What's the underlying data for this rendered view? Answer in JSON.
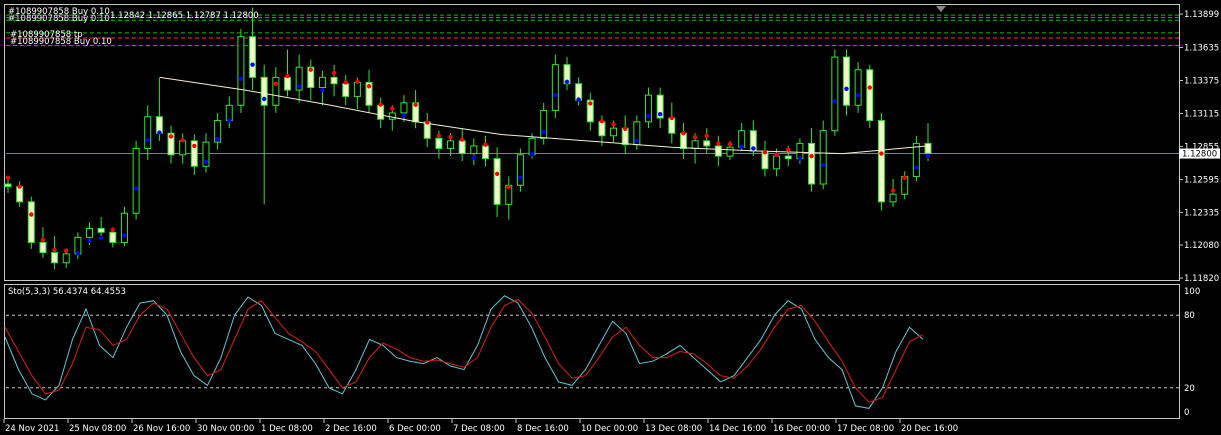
{
  "header": {
    "top_text": "#1089907858 Buy 0.10",
    "quote_text": "1.12842 1.12865 1.12787 1.12800",
    "tp_label": "#1089907858 tp",
    "buy_label": "#1089907858 Buy 0.10"
  },
  "indicator": {
    "label": "Sto(5,3,3) 56.4374 64.4553"
  },
  "colors": {
    "background": "#000000",
    "candle_up_fill": "#000000",
    "candle_down_fill": "#f0f8c8",
    "candle_wick": "#2ee52e",
    "ma_line": "#f5f0d0",
    "psar_up": "#0000ff",
    "psar_down": "#ff0000",
    "stoch_main": "#5fc8d8",
    "stoch_signal": "#e01a1a",
    "level_green": "#00c800",
    "level_red": "#ff3030",
    "grid_dotted": "#c8c8c8",
    "price_line": "#708090"
  },
  "chart_data": [
    {
      "type": "candlestick",
      "price_axis_labels": [
        "1.13899",
        "1.13635",
        "1.13375",
        "1.13115",
        "1.12855",
        "1.12595",
        "1.12335",
        "1.12080",
        "1.11820"
      ],
      "current_price_label": "1.12800",
      "ylim": [
        1.1182,
        1.13899
      ],
      "time_axis_labels": [
        "24 Nov 2021",
        "25 Nov 08:00",
        "26 Nov 16:00",
        "30 Nov 00:00",
        "1 Dec 08:00",
        "2 Dec 16:00",
        "6 Dec 00:00",
        "7 Dec 08:00",
        "8 Dec 16:00",
        "10 Dec 00:00",
        "13 Dec 08:00",
        "14 Dec 16:00",
        "16 Dec 00:00",
        "17 Dec 08:00",
        "20 Dec 16:00"
      ],
      "current_price": 1.128,
      "order_levels": [
        1.1389,
        1.1387,
        1.1385,
        1.1375,
        1.1371,
        1.1365
      ],
      "candles_ohlc": [
        [
          1.1256,
          1.1262,
          1.1249,
          1.1254
        ],
        [
          1.1254,
          1.1258,
          1.1238,
          1.1242
        ],
        [
          1.1242,
          1.1246,
          1.1205,
          1.121
        ],
        [
          1.121,
          1.1222,
          1.1198,
          1.1202
        ],
        [
          1.1202,
          1.1215,
          1.1189,
          1.1194
        ],
        [
          1.1194,
          1.1205,
          1.119,
          1.1201
        ],
        [
          1.1201,
          1.1218,
          1.1197,
          1.1214
        ],
        [
          1.1214,
          1.1226,
          1.1208,
          1.1221
        ],
        [
          1.1221,
          1.123,
          1.1212,
          1.1218
        ],
        [
          1.1218,
          1.1222,
          1.1206,
          1.121
        ],
        [
          1.121,
          1.1238,
          1.1207,
          1.1233
        ],
        [
          1.1233,
          1.129,
          1.1228,
          1.1284
        ],
        [
          1.1284,
          1.1318,
          1.1275,
          1.1309
        ],
        [
          1.1309,
          1.134,
          1.129,
          1.1296
        ],
        [
          1.1296,
          1.1302,
          1.1272,
          1.1279
        ],
        [
          1.1279,
          1.1296,
          1.1272,
          1.129
        ],
        [
          1.129,
          1.1295,
          1.1263,
          1.127
        ],
        [
          1.127,
          1.1296,
          1.1265,
          1.1289
        ],
        [
          1.1289,
          1.1312,
          1.1283,
          1.1306
        ],
        [
          1.1306,
          1.1325,
          1.13,
          1.1318
        ],
        [
          1.1318,
          1.1378,
          1.1312,
          1.1372
        ],
        [
          1.1372,
          1.1395,
          1.133,
          1.134
        ],
        [
          1.134,
          1.135,
          1.124,
          1.1318
        ],
        [
          1.1318,
          1.1348,
          1.1312,
          1.134
        ],
        [
          1.134,
          1.1362,
          1.1325,
          1.133
        ],
        [
          1.133,
          1.1358,
          1.132,
          1.1348
        ],
        [
          1.1348,
          1.1354,
          1.1322,
          1.1332
        ],
        [
          1.1332,
          1.1345,
          1.1318,
          1.134
        ],
        [
          1.134,
          1.135,
          1.1325,
          1.1335
        ],
        [
          1.1335,
          1.1342,
          1.1318,
          1.1325
        ],
        [
          1.1325,
          1.134,
          1.1315,
          1.1336
        ],
        [
          1.1336,
          1.1346,
          1.1312,
          1.1318
        ],
        [
          1.1318,
          1.1324,
          1.13,
          1.1307
        ],
        [
          1.1307,
          1.1318,
          1.1298,
          1.1312
        ],
        [
          1.1312,
          1.1326,
          1.1305,
          1.132
        ],
        [
          1.132,
          1.133,
          1.13,
          1.1305
        ],
        [
          1.1305,
          1.1312,
          1.1285,
          1.1292
        ],
        [
          1.1292,
          1.1298,
          1.1276,
          1.1284
        ],
        [
          1.1284,
          1.1296,
          1.1278,
          1.129
        ],
        [
          1.129,
          1.13,
          1.1274,
          1.128
        ],
        [
          1.128,
          1.1292,
          1.1271,
          1.1286
        ],
        [
          1.1286,
          1.1294,
          1.127,
          1.1276
        ],
        [
          1.1276,
          1.1285,
          1.123,
          1.124
        ],
        [
          1.124,
          1.1262,
          1.1228,
          1.1255
        ],
        [
          1.1255,
          1.1284,
          1.125,
          1.1279
        ],
        [
          1.1279,
          1.1296,
          1.1276,
          1.1292
        ],
        [
          1.1292,
          1.132,
          1.1287,
          1.1314
        ],
        [
          1.1314,
          1.1358,
          1.1308,
          1.135
        ],
        [
          1.135,
          1.1356,
          1.133,
          1.1335
        ],
        [
          1.1335,
          1.134,
          1.1318,
          1.1322
        ],
        [
          1.1322,
          1.1328,
          1.1298,
          1.1305
        ],
        [
          1.1305,
          1.131,
          1.1286,
          1.1294
        ],
        [
          1.1294,
          1.1306,
          1.1289,
          1.13
        ],
        [
          1.13,
          1.131,
          1.128,
          1.1287
        ],
        [
          1.1287,
          1.131,
          1.1283,
          1.1305
        ],
        [
          1.1305,
          1.1332,
          1.13,
          1.1326
        ],
        [
          1.1326,
          1.1332,
          1.13,
          1.1308
        ],
        [
          1.1308,
          1.132,
          1.1288,
          1.1296
        ],
        [
          1.1296,
          1.1304,
          1.1276,
          1.1284
        ],
        [
          1.1284,
          1.1296,
          1.1272,
          1.129
        ],
        [
          1.129,
          1.13,
          1.128,
          1.1286
        ],
        [
          1.1286,
          1.1294,
          1.127,
          1.1278
        ],
        [
          1.1278,
          1.129,
          1.1275,
          1.1285
        ],
        [
          1.1285,
          1.1304,
          1.1282,
          1.1298
        ],
        [
          1.1298,
          1.1306,
          1.1278,
          1.1282
        ],
        [
          1.1282,
          1.129,
          1.1262,
          1.1268
        ],
        [
          1.1268,
          1.1284,
          1.1262,
          1.1278
        ],
        [
          1.1278,
          1.1286,
          1.127,
          1.1276
        ],
        [
          1.1276,
          1.1292,
          1.1272,
          1.1288
        ],
        [
          1.1288,
          1.13,
          1.125,
          1.1256
        ],
        [
          1.1256,
          1.1306,
          1.1252,
          1.1298
        ],
        [
          1.1298,
          1.1362,
          1.1294,
          1.1356
        ],
        [
          1.1356,
          1.1362,
          1.131,
          1.1318
        ],
        [
          1.1318,
          1.1352,
          1.1312,
          1.1346
        ],
        [
          1.1346,
          1.135,
          1.13,
          1.1306
        ],
        [
          1.1306,
          1.1312,
          1.1235,
          1.1242
        ],
        [
          1.1242,
          1.126,
          1.1238,
          1.1248
        ],
        [
          1.1248,
          1.1266,
          1.1244,
          1.1262
        ],
        [
          1.1262,
          1.1294,
          1.1258,
          1.1288
        ],
        [
          1.1288,
          1.1304,
          1.1274,
          1.128
        ]
      ],
      "moving_average": [
        1.134,
        1.133,
        1.1318,
        1.1305,
        1.1295,
        1.129,
        1.1285,
        1.1282,
        1.128,
        1.1286
      ],
      "psar_dots": "blue below price in uptrends, red above price in downtrends"
    },
    {
      "type": "line",
      "title": "Sto(5,3,3)",
      "ylim": [
        0,
        100
      ],
      "y_axis_labels": [
        "100",
        "80",
        "20",
        "0"
      ],
      "levels": [
        80,
        20
      ],
      "series": [
        {
          "name": "main",
          "values": [
            62,
            35,
            15,
            10,
            22,
            60,
            85,
            55,
            45,
            70,
            90,
            92,
            80,
            50,
            30,
            22,
            45,
            80,
            95,
            88,
            65,
            60,
            55,
            40,
            20,
            15,
            35,
            60,
            55,
            45,
            42,
            40,
            45,
            38,
            35,
            55,
            85,
            96,
            90,
            70,
            45,
            25,
            22,
            35,
            55,
            75,
            65,
            40,
            42,
            48,
            55,
            45,
            35,
            25,
            30,
            45,
            60,
            80,
            92,
            85,
            60,
            45,
            35,
            5,
            3,
            20,
            50,
            70,
            60
          ]
        },
        {
          "name": "signal",
          "values": [
            70,
            50,
            30,
            15,
            18,
            40,
            70,
            68,
            55,
            60,
            80,
            90,
            85,
            65,
            45,
            30,
            35,
            60,
            85,
            92,
            78,
            65,
            58,
            50,
            35,
            20,
            25,
            45,
            57,
            52,
            45,
            42,
            43,
            40,
            37,
            45,
            70,
            88,
            93,
            82,
            62,
            40,
            28,
            30,
            45,
            62,
            70,
            55,
            45,
            45,
            50,
            48,
            40,
            30,
            28,
            38,
            52,
            70,
            85,
            88,
            75,
            58,
            42,
            20,
            8,
            12,
            35,
            58,
            64
          ]
        }
      ],
      "current_values": {
        "main": 56.4374,
        "signal": 64.4553
      }
    }
  ]
}
